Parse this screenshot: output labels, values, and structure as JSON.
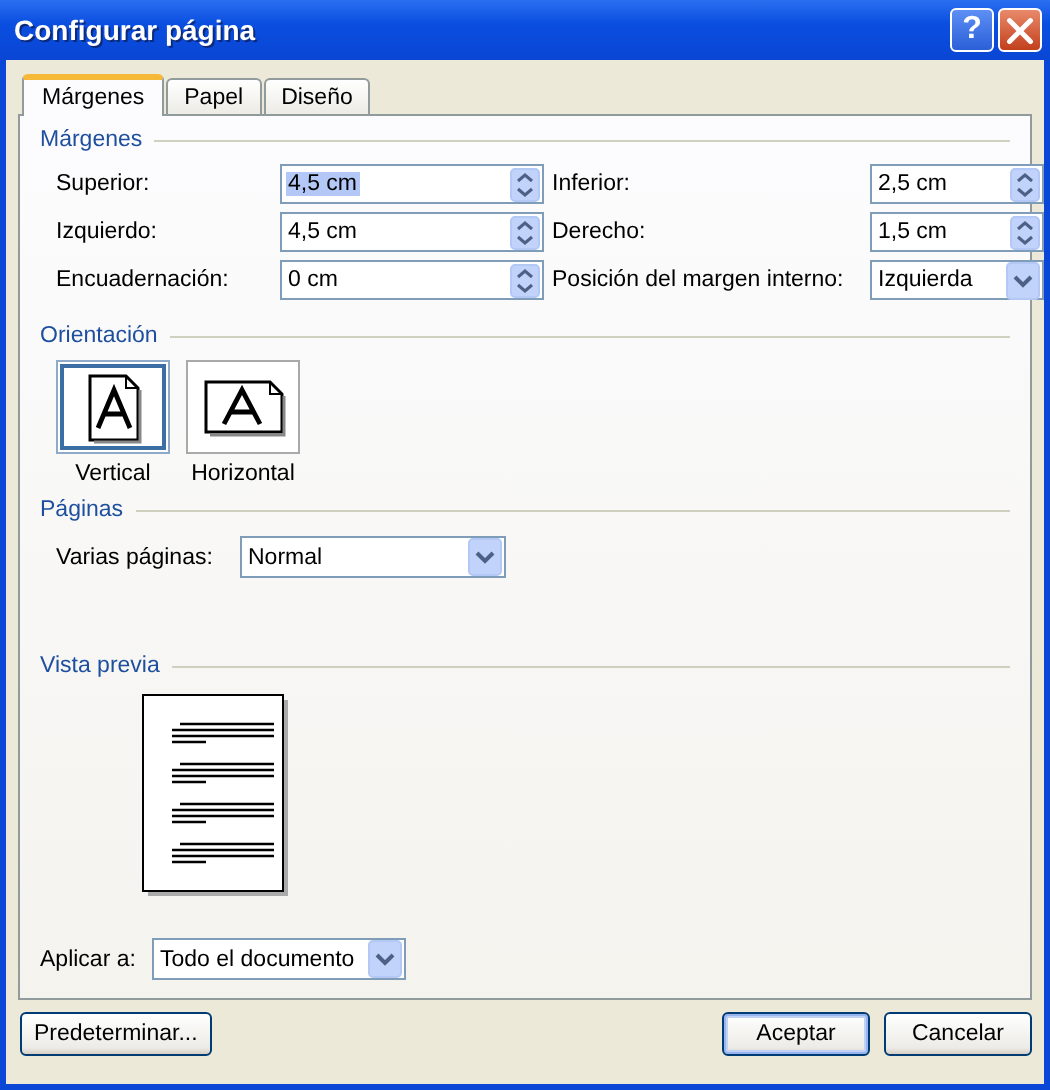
{
  "window": {
    "title": "Configurar página",
    "help_button": "?"
  },
  "tabs": [
    {
      "label": "Márgenes",
      "selected": true
    },
    {
      "label": "Papel",
      "selected": false
    },
    {
      "label": "Diseño",
      "selected": false
    }
  ],
  "margins": {
    "heading": "Márgenes",
    "fields": [
      {
        "label": "Superior:",
        "value": "4,5 cm",
        "kind": "spin",
        "selected": true
      },
      {
        "label": "Inferior:",
        "value": "2,5 cm",
        "kind": "spin",
        "selected": false
      },
      {
        "label": "Izquierdo:",
        "value": "4,5 cm",
        "kind": "spin",
        "selected": false
      },
      {
        "label": "Derecho:",
        "value": "1,5 cm",
        "kind": "spin",
        "selected": false
      },
      {
        "label": "Encuadernación:",
        "value": "0 cm",
        "kind": "spin",
        "selected": false
      },
      {
        "label": "Posición del margen interno:",
        "value": "Izquierda",
        "kind": "dropdown",
        "selected": false
      }
    ]
  },
  "orientation": {
    "heading": "Orientación",
    "options": [
      {
        "label": "Vertical",
        "kind": "portrait",
        "selected": true
      },
      {
        "label": "Horizontal",
        "kind": "landscape",
        "selected": false
      }
    ]
  },
  "pages": {
    "heading": "Páginas",
    "label": "Varias páginas:",
    "value": "Normal"
  },
  "preview": {
    "heading": "Vista previa"
  },
  "apply": {
    "label": "Aplicar a:",
    "value": "Todo el documento"
  },
  "buttons": [
    {
      "label": "Predeterminar...",
      "kind": "left",
      "default": false
    },
    {
      "label": "Aceptar",
      "kind": "right",
      "default": true
    },
    {
      "label": "Cancelar",
      "kind": "right",
      "default": false
    }
  ]
}
